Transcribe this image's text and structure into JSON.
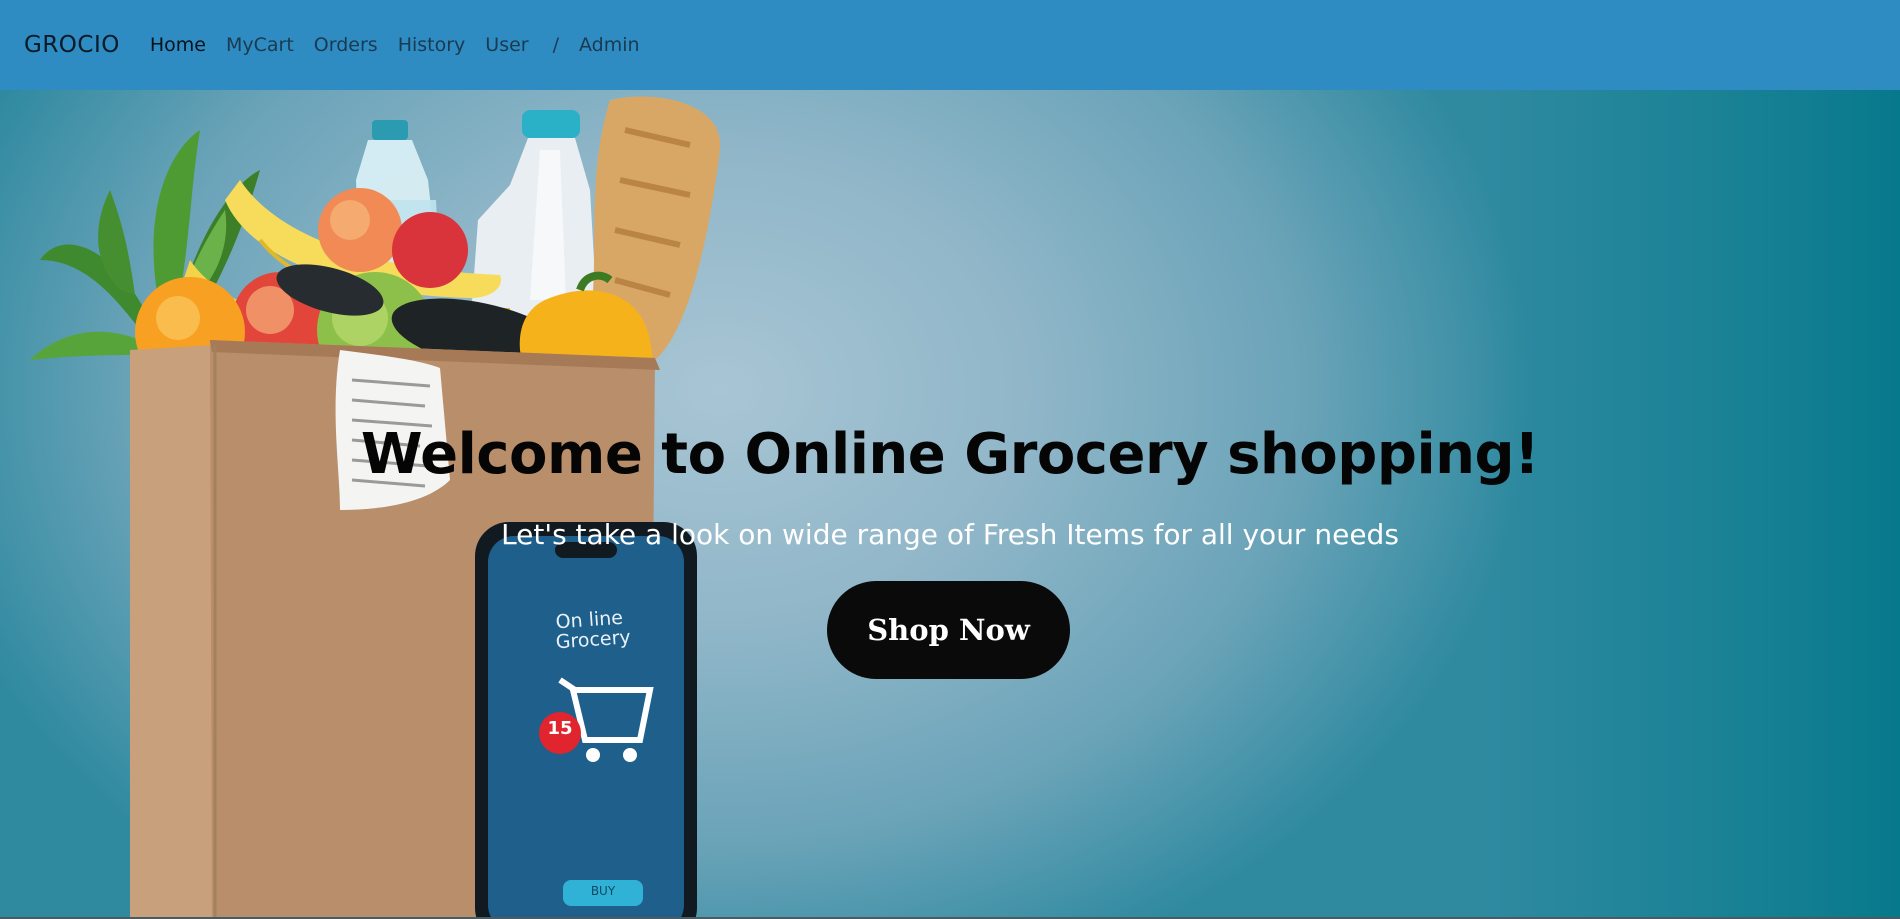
{
  "navbar": {
    "brand": "GROCIO",
    "links": [
      {
        "label": "Home"
      },
      {
        "label": "MyCart"
      },
      {
        "label": "Orders"
      },
      {
        "label": "History"
      },
      {
        "label": "User"
      }
    ],
    "separator": "/",
    "admin_label": "Admin"
  },
  "hero": {
    "title": "Welcome to Online Grocery shopping!",
    "subtitle": "Let's take a look on wide range of Fresh Items for all your needs",
    "cta_label": "Shop Now",
    "phone_screen_text_line1": "On line",
    "phone_screen_text_line2": "Grocery",
    "cart_badge_count": "15",
    "phone_button_label": "BUY"
  },
  "colors": {
    "navbar_bg": "#2e8cc2",
    "hero_bg": "#8fb6c8",
    "cta_bg": "#0b0a0a",
    "cart_badge": "#e0252f"
  },
  "icons": [
    "grocery-bag-image",
    "shopping-cart-icon"
  ]
}
